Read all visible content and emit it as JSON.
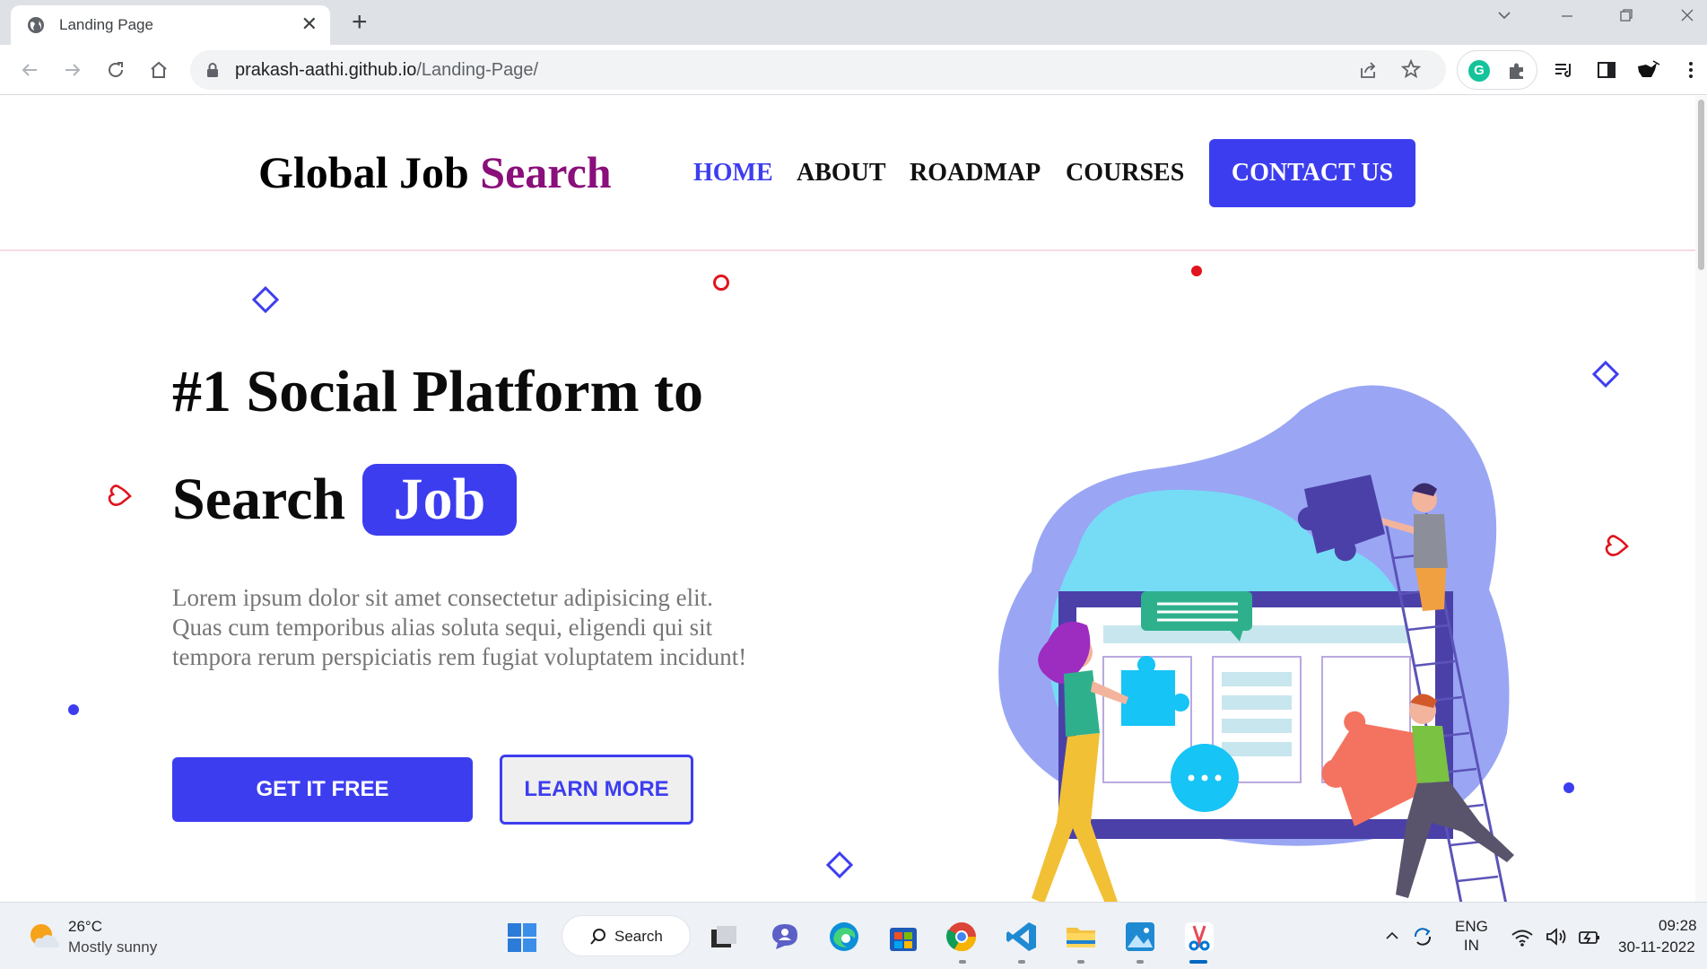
{
  "browser": {
    "tab_title": "Landing Page",
    "url_host": "prakash-aathi.github.io",
    "url_path": "/Landing-Page/",
    "extension_badge": "G"
  },
  "site": {
    "logo_main": "Global Job ",
    "logo_accent": "Search",
    "nav": [
      "HOME",
      "ABOUT",
      "ROADMAP",
      "COURSES"
    ],
    "contact_label": "CONTACT US",
    "hero_line1": "#1 Social Platform to",
    "hero_line2": "Search",
    "hero_highlight": "Job",
    "hero_paragraph": "Lorem ipsum dolor sit amet consectetur adipisicing elit. Quas cum temporibus alias soluta sequi, eligendi qui sit tempora rerum perspiciatis rem fugiat voluptatem incidunt!",
    "cta_primary": "GET IT FREE",
    "cta_secondary": "LEARN MORE"
  },
  "colors": {
    "accent_blue": "#3d3df0",
    "logo_accent": "#8a0f7a",
    "deco_red": "#e0141e"
  },
  "taskbar": {
    "weather_temp": "26°C",
    "weather_desc": "Mostly sunny",
    "search_label": "Search",
    "lang_line1": "ENG",
    "lang_line2": "IN",
    "time": "09:28",
    "date": "30-11-2022"
  }
}
